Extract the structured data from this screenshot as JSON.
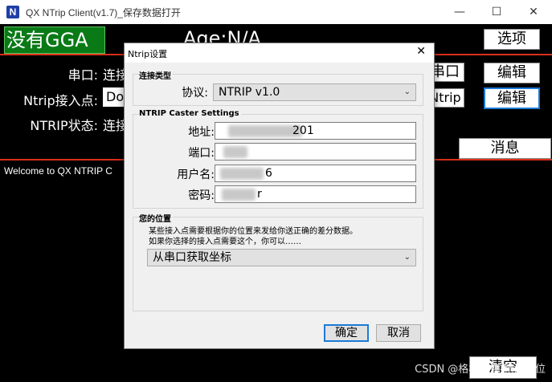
{
  "window": {
    "title": "QX NTrip Client(v1.7)_保存数据打开",
    "icon_letter": "N",
    "minimize": "—",
    "maximize": "☐",
    "close": "✕"
  },
  "main": {
    "gga_status": "没有GGA",
    "age": "Age:N/A",
    "options_button": "选项",
    "serial_label": "串口:",
    "serial_value": "连接",
    "serial_button": "串口",
    "serial_edit": "编辑",
    "mount_label": "Ntrip接入点:",
    "mount_value": "Do",
    "ntrip_button": "Ntrip",
    "ntrip_edit": "编辑",
    "state_label": "NTRIP状态:",
    "state_value": "连接",
    "message_button": "消息",
    "welcome_text": "Welcome to QX NTRIP C",
    "clear_button": "清空",
    "watermark": "CSDN @格林恩德-精准定位"
  },
  "dialog": {
    "title": "Ntrip设置",
    "close": "✕",
    "conn_group": "连接类型",
    "protocol_label": "协议:",
    "protocol_value": "NTRIP v1.0",
    "caster_group": "NTRIP Caster Settings",
    "address_label": "地址:",
    "address_value": "201",
    "port_label": "端口:",
    "port_value": "",
    "user_label": "用户名:",
    "user_value": "6",
    "pass_label": "密码:",
    "pass_value": "r",
    "location_group": "您的位置",
    "hint_line1": "某些接入点需要根据你的位置来发给你送正确的差分数据。",
    "hint_line2": "如果你选择的接入点需要这个，你可以……",
    "location_value": "从串口获取坐标",
    "ok_button": "确定",
    "cancel_button": "取消"
  },
  "colors": {
    "gga_bg": "#0a7a16",
    "divider": "#d9301a",
    "focus": "#1c7ad6"
  }
}
